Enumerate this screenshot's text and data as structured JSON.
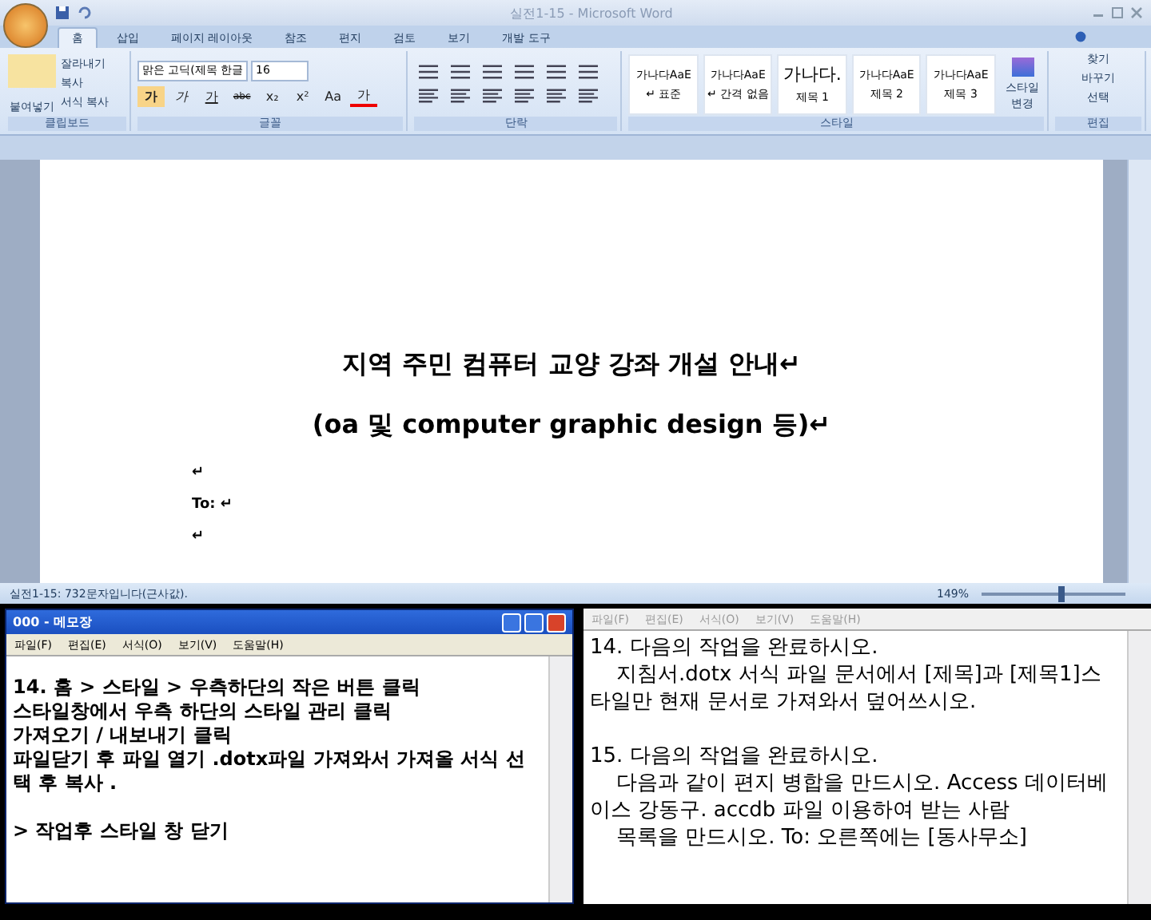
{
  "window": {
    "title": "실전1-15 - Microsoft Word"
  },
  "tabs": [
    {
      "label": "홈",
      "selected": true
    },
    {
      "label": "삽입",
      "selected": false
    },
    {
      "label": "페이지 레이아웃",
      "selected": false
    },
    {
      "label": "참조",
      "selected": false
    },
    {
      "label": "편지",
      "selected": false
    },
    {
      "label": "검토",
      "selected": false
    },
    {
      "label": "보기",
      "selected": false
    },
    {
      "label": "개발 도구",
      "selected": false
    }
  ],
  "clipboard": {
    "paste": "붙여넣기",
    "small": [
      "잘라내기",
      "복사",
      "서식 복사"
    ],
    "label": "클립보드"
  },
  "font": {
    "name": "맑은 고딕(제목 한글",
    "size": "16",
    "buttons": [
      "가",
      "가",
      "가",
      "abc",
      "x₂",
      "x²",
      "Aa",
      "가"
    ],
    "label": "글꼴"
  },
  "paragraph": {
    "label": "단락"
  },
  "styles": {
    "items": [
      {
        "sample": "가나다AaE",
        "name": "↵ 표준",
        "kind": "normal"
      },
      {
        "sample": "가나다AaE",
        "name": "↵ 간격 없음",
        "kind": "normal"
      },
      {
        "sample": "가나다.",
        "name": "제목 1",
        "kind": "heading"
      },
      {
        "sample": "가나다AaE",
        "name": "제목 2",
        "kind": "normal"
      },
      {
        "sample": "가나다AaE",
        "name": "제목 3",
        "kind": "normal"
      }
    ],
    "change": "스타일 변경",
    "label": "스타일"
  },
  "editing": {
    "items": [
      "찾기",
      "바꾸기",
      "선택"
    ],
    "label": "편집"
  },
  "document": {
    "title": "지역 주민 컴퓨터 교양 강좌 개설 안내↵",
    "subtitle": "(oa 및 computer graphic design 등)↵",
    "lines": [
      "↵",
      "To: ↵",
      "↵"
    ]
  },
  "status_bar": {
    "text": "실전1-15: 732문자입니다(근사값).",
    "zoom": "149%",
    "level": 0.55
  },
  "notepad": {
    "title": "000 - 메모장",
    "menu": [
      "파일(F)",
      "편집(E)",
      "서식(O)",
      "보기(V)",
      "도움말(H)"
    ],
    "paragraphs": [
      [
        "14. 홈 > 스타일 > 우측하단의 작은 버튼 클릭",
        "스타일창에서 우측 하단의 스타일 관리 클릭",
        "가져오기 / 내보내기 클릭",
        "파일닫기 후 파일 열기 .dotx파일 가져와서 가져올 서식 선택 후 복사 ."
      ],
      [
        "> 작업후 스타일 창 닫기"
      ]
    ]
  },
  "notepad2": {
    "menu": [
      "파일(F)",
      "편집(E)",
      "서식(O)",
      "보기(V)",
      "도움말(H)"
    ],
    "paragraphs": [
      [
        "14. 다음의 작업을 완료하시오.",
        "    지침서.dotx 서식 파일 문서에서 [제목]과 [제목1]스타일만 현재 문서로 가져와서 덮어쓰시오."
      ],
      [
        "15. 다음의 작업을 완료하시오.",
        "    다음과 같이 편지 병합을 만드시오. Access 데이터베이스 강동구. accdb 파일 이용하여 받는 사람",
        "    목록을 만드시오. To: 오른쪽에는 [동사무소]"
      ]
    ]
  }
}
